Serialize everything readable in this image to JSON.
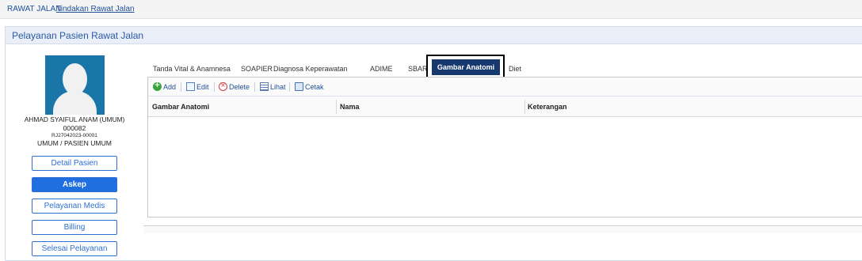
{
  "breadcrumb": {
    "root": "RAWAT JALAN",
    "current": "Tindakan Rawat Jalan"
  },
  "panel": {
    "title": "Pelayanan Pasien Rawat Jalan"
  },
  "patient": {
    "name": "AHMAD SYAIFUL ANAM (UMUM)",
    "id": "000082",
    "registration": "RJ27042023-00001",
    "category": "UMUM / PASIEN UMUM"
  },
  "side_buttons": {
    "detail": "Detail Pasien",
    "askep": "Askep",
    "pelayanan_medis": "Pelayanan Medis",
    "billing": "Billing",
    "selesai": "Selesai Pelayanan"
  },
  "tabs": {
    "vital": "Tanda Vital & Anamnesa",
    "soapier": "SOAPIER",
    "diagnosa": "Diagnosa Keperawatan",
    "adime": "ADIME",
    "sbar": "SBAR",
    "gambar": "Gambar Anatomi",
    "diet": "Diet"
  },
  "toolbar": {
    "add": "Add",
    "edit": "Edit",
    "delete": "Delete",
    "lihat": "Lihat",
    "cetak": "Cetak"
  },
  "table": {
    "columns": [
      "Gambar Anatomi",
      "Nama",
      "Keterangan"
    ]
  },
  "colors": {
    "accent": "#1f6fe0",
    "active_tab": "#17396f",
    "highlight_border": "#000000"
  }
}
